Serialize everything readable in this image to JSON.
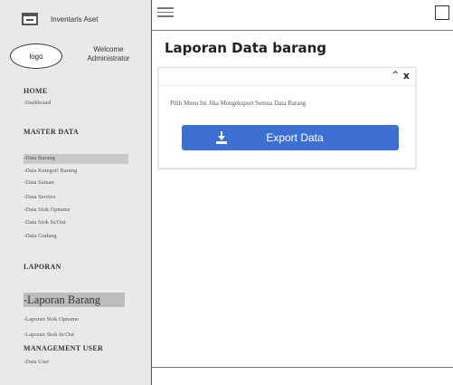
{
  "app": {
    "brand_name": "Inventaris Aset",
    "logo_text": "logo",
    "welcome_line1": "Welcome",
    "welcome_line2": "Administrator"
  },
  "sidebar": {
    "home_heading": "HOME",
    "dashboard": "-Dashboard",
    "master_heading": "MASTER DATA",
    "master_items": [
      "-Data Barang",
      "-Data Kategori Barang",
      "-Data Satuan",
      "-Data Service",
      "-Data Stok Opname",
      "-Data Stok In/Out",
      "-Data Gudang"
    ],
    "laporan_heading": "LAPORAN",
    "laporan_items": [
      "-Laporan Barang",
      "-Laporan Stok Opname",
      "-Laporan Stok In/Out"
    ],
    "management_heading": "MANAGEMENT USER",
    "management_items": [
      "-Data User"
    ]
  },
  "main": {
    "title": "Laporan Data barang",
    "card": {
      "collapse_glyph": "^",
      "close_glyph": "x",
      "description": "Pilih Menu Ini Jika Mengeksport Semua Data Barang",
      "export_label": "Export Data"
    }
  },
  "colors": {
    "button": "#3d6fd2",
    "sidebar_bg": "#e9e9e9"
  }
}
